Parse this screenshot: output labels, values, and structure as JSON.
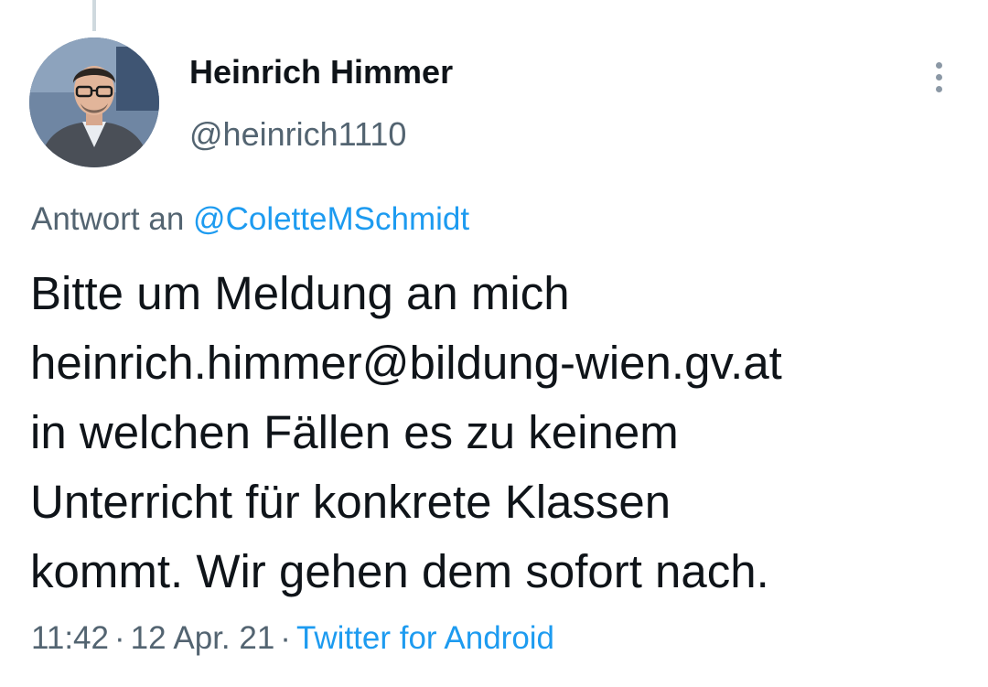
{
  "tweet": {
    "author": {
      "display_name": "Heinrich Himmer",
      "handle": "@heinrich1110"
    },
    "reply": {
      "prefix": "Antwort an",
      "mention": "@ColetteMSchmidt"
    },
    "text_lines": [
      "Bitte um Meldung an mich",
      "heinrich.himmer@bildung-wien.gv.at",
      "in welchen Fällen es zu keinem",
      "Unterricht für konkrete Klassen",
      "kommt. Wir gehen dem sofort nach."
    ],
    "time": "11:42",
    "date": "12 Apr. 21",
    "separator": "·",
    "source": "Twitter for Android"
  },
  "icons": {
    "more": "more-vertical-icon",
    "avatar": "profile-photo"
  },
  "colors": {
    "text_primary": "#0f1419",
    "text_secondary": "#536471",
    "link": "#1d9bf0",
    "thread_line": "#cfd9de"
  }
}
